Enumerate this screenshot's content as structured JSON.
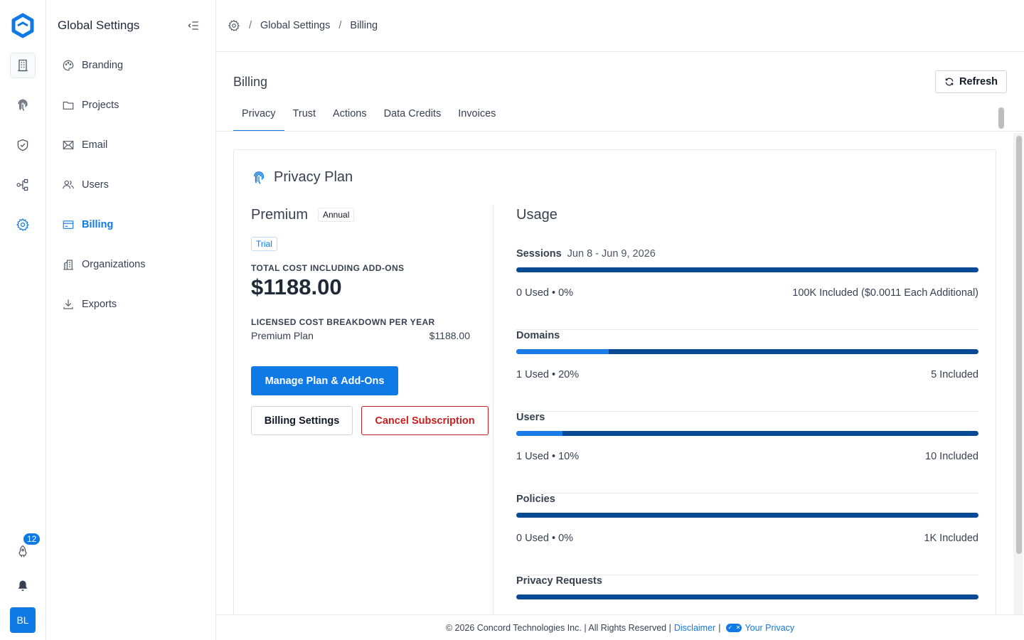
{
  "brand": {
    "accent": "#0f7ae5",
    "bar_dark": "#0a4a94",
    "danger": "#c81e1e"
  },
  "rail": {
    "items": [
      {
        "icon": "building-icon",
        "active": false
      },
      {
        "icon": "fingerprint-icon",
        "active": false
      },
      {
        "icon": "shield-check-icon",
        "active": false
      },
      {
        "icon": "workflow-icon",
        "active": false
      },
      {
        "icon": "gear-icon",
        "active": true
      }
    ],
    "notification_count": "12",
    "avatar_initials": "BL"
  },
  "sidebar": {
    "title": "Global Settings",
    "items": [
      {
        "label": "Branding",
        "icon": "palette-icon"
      },
      {
        "label": "Projects",
        "icon": "folder-icon"
      },
      {
        "label": "Email",
        "icon": "mail-icon"
      },
      {
        "label": "Users",
        "icon": "users-icon"
      },
      {
        "label": "Billing",
        "icon": "credit-card-icon",
        "active": true
      },
      {
        "label": "Organizations",
        "icon": "building-icon"
      },
      {
        "label": "Exports",
        "icon": "download-icon"
      }
    ]
  },
  "breadcrumb": {
    "items": [
      "Global Settings",
      "Billing"
    ]
  },
  "page": {
    "title": "Billing",
    "refresh_label": "Refresh",
    "tabs": [
      "Privacy",
      "Trust",
      "Actions",
      "Data Credits",
      "Invoices"
    ],
    "active_tab": "Privacy"
  },
  "plan": {
    "card_title": "Privacy Plan",
    "name": "Premium",
    "term": "Annual",
    "status": "Trial",
    "total_label": "TOTAL COST INCLUDING ADD-ONS",
    "total_value": "$1188.00",
    "breakdown_label": "LICENSED COST BREAKDOWN PER YEAR",
    "breakdown_item": "Premium Plan",
    "breakdown_value": "$1188.00",
    "manage_label": "Manage Plan & Add-Ons",
    "settings_label": "Billing Settings",
    "cancel_label": "Cancel Subscription"
  },
  "usage": {
    "title": "Usage",
    "rows": [
      {
        "name": "Sessions",
        "period": "Jun 8 - Jun 9, 2026",
        "used": "0 Used • 0%",
        "included": "100K Included ($0.0011 Each Additional)",
        "fraction": 0
      },
      {
        "name": "Domains",
        "period": "",
        "used": "1 Used • 20%",
        "included": "5 Included",
        "fraction": 0.2
      },
      {
        "name": "Users",
        "period": "",
        "used": "1 Used • 10%",
        "included": "10 Included",
        "fraction": 0.1
      },
      {
        "name": "Policies",
        "period": "",
        "used": "0 Used • 0%",
        "included": "1K Included",
        "fraction": 0
      },
      {
        "name": "Privacy Requests",
        "period": "",
        "used": "",
        "included": "",
        "fraction": 0
      }
    ]
  },
  "footer": {
    "copyright": "© 2026 Concord Technologies Inc. | All Rights Reserved |",
    "disclaimer": "Disclaimer",
    "pipe": "|",
    "privacy": "Your Privacy"
  }
}
